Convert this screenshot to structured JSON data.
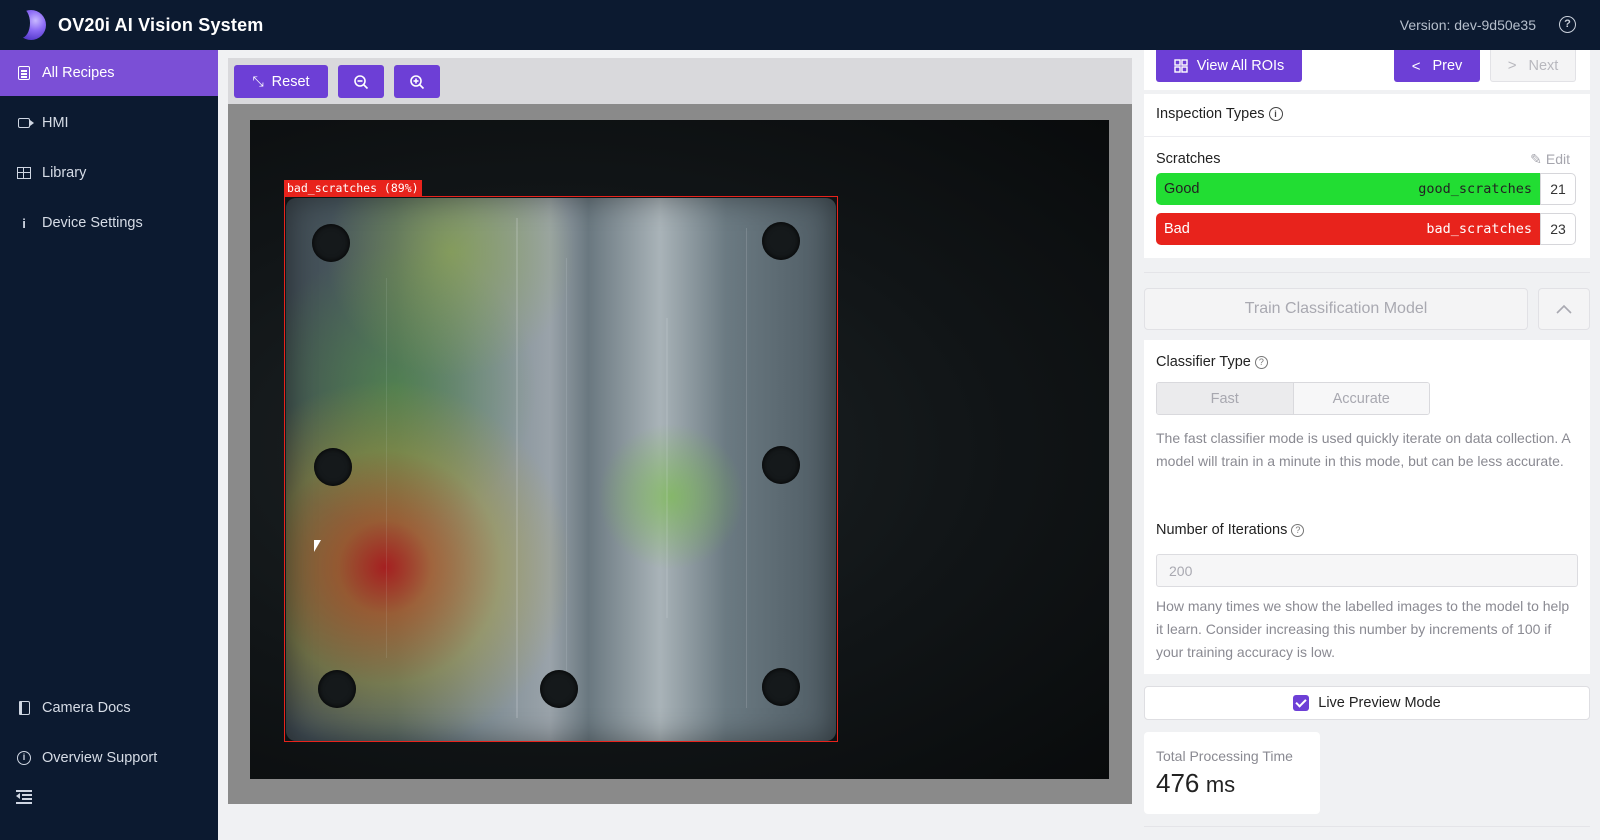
{
  "header": {
    "title": "OV20i AI Vision System",
    "version": "Version: dev-9d50e35",
    "help_glyph": "?"
  },
  "sidebar": {
    "items": [
      {
        "label": "All Recipes",
        "icon": "document-list-icon",
        "active": true
      },
      {
        "label": "HMI",
        "icon": "camera-icon",
        "active": false
      },
      {
        "label": "Library",
        "icon": "grid-icon",
        "active": false
      },
      {
        "label": "Device Settings",
        "icon": "info-icon",
        "active": false
      }
    ],
    "bottom_items": [
      {
        "label": "Camera Docs",
        "icon": "book-icon"
      },
      {
        "label": "Overview Support",
        "icon": "info-circle-icon"
      }
    ],
    "collapse_icon": "collapse-menu-icon"
  },
  "toolbar": {
    "reset_label": "Reset",
    "zoom_out_icon": "zoom-out-icon",
    "zoom_in_icon": "zoom-in-icon"
  },
  "viewer": {
    "roi_label": "bad_scratches (89%)"
  },
  "roi_nav": {
    "view_all_label": "View All ROIs",
    "prev_label": "Prev",
    "next_label": "Next"
  },
  "inspection_types": {
    "title": "Inspection Types",
    "info_glyph": "i",
    "group_name": "Scratches",
    "edit_label": "Edit",
    "classes": [
      {
        "label": "Good",
        "code": "good_scratches",
        "count": "21",
        "color": "#22dd33"
      },
      {
        "label": "Bad",
        "code": "bad_scratches",
        "count": "23",
        "color": "#e8231c"
      }
    ]
  },
  "training": {
    "train_label": "Train Classification Model",
    "classifier_type_label": "Classifier Type",
    "help_glyph": "?",
    "options": [
      "Fast",
      "Accurate"
    ],
    "selected_option": "Fast",
    "classifier_description": "The fast classifier mode is used quickly iterate on data collection. A model will train in a minute in this mode, but can be less accurate.",
    "iterations_label": "Number of Iterations",
    "iterations_value": "200",
    "iterations_description": "How many times we show the labelled images to the model to help it learn. Consider increasing this number by increments of 100 if your training accuracy is low."
  },
  "live_preview": {
    "label": "Live Preview Mode",
    "checked": true
  },
  "processing": {
    "label": "Total Processing Time",
    "value": "476",
    "unit": "ms"
  },
  "colors": {
    "brand_purple": "#6d3fd6",
    "sidebar_bg": "#0c1a30",
    "good_green": "#22dd33",
    "bad_red": "#e8231c"
  }
}
